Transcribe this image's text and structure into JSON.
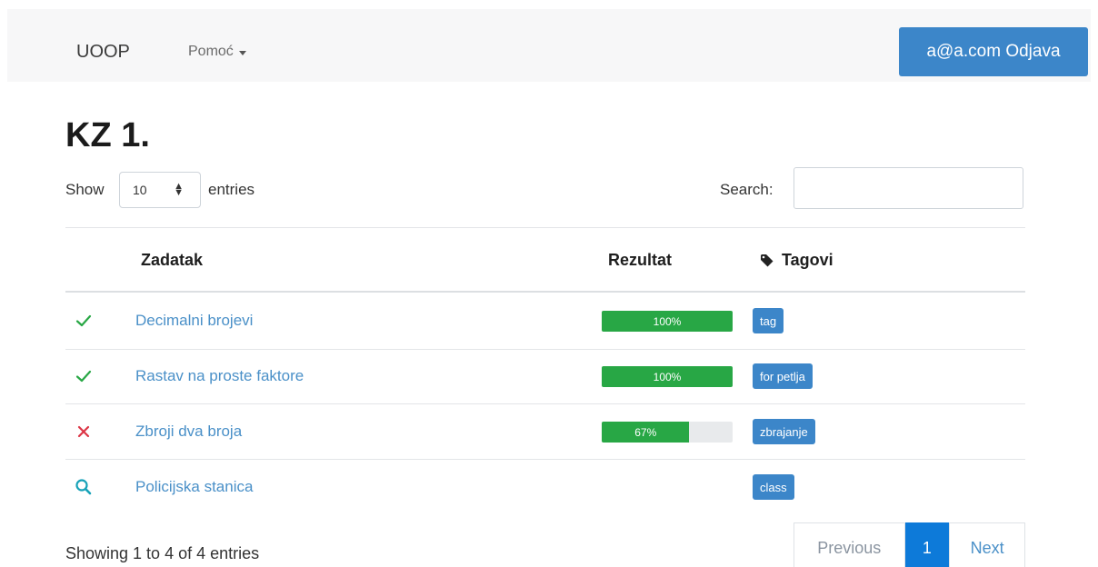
{
  "navbar": {
    "brand": "UOOP",
    "help_menu": "Pomoć",
    "logout_button": "a@a.com Odjava"
  },
  "page": {
    "title": "KZ 1."
  },
  "controls": {
    "show_label": "Show",
    "entries_select_value": "10",
    "entries_label": "entries",
    "search_label": "Search:",
    "search_value": "",
    "search_placeholder": ""
  },
  "table": {
    "headers": {
      "task": "Zadatak",
      "result": "Rezultat",
      "tags": "Tagovi"
    },
    "rows": [
      {
        "status": "check-icon",
        "task": "Decimalni brojevi",
        "progress": 100,
        "progress_label": "100%",
        "tag": "tag"
      },
      {
        "status": "check-icon",
        "task": "Rastav na proste faktore",
        "progress": 100,
        "progress_label": "100%",
        "tag": "for petlja"
      },
      {
        "status": "cross-icon",
        "task": "Zbroji dva broja",
        "progress": 67,
        "progress_label": "67%",
        "tag": "zbrajanje"
      },
      {
        "status": "search-icon",
        "task": "Policijska stanica",
        "progress": null,
        "progress_label": "",
        "tag": "class"
      }
    ]
  },
  "footer": {
    "info": "Showing 1 to 4 of 4 entries",
    "pagination": {
      "previous": "Previous",
      "current": "1",
      "next": "Next"
    }
  },
  "colors": {
    "primary": "#3c86c9",
    "success": "#28a745",
    "danger": "#dc3545",
    "info": "#17a2b8",
    "link": "#4a90c8"
  }
}
